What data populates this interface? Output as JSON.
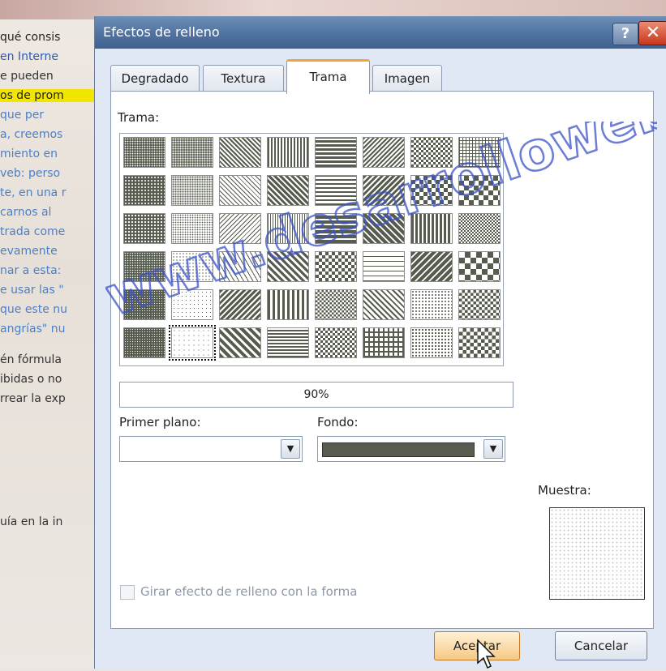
{
  "background_document": {
    "lines": [
      "qué consis",
      "en Interne",
      "e pueden",
      "os de prom",
      "que per",
      "a, creemos",
      "miento en",
      "veb: perso",
      "te, en una r",
      "carnos al",
      "trada come",
      "evamente",
      "nar a esta:",
      "e usar las \"",
      "que este nu",
      "angrías\" nu",
      "én fórmula",
      "ibidas o no",
      "rrear la exp",
      "uía en la in"
    ]
  },
  "dialog": {
    "title": "Efectos de relleno",
    "help_label": "?",
    "close_label": "✕",
    "tabs": [
      {
        "label": "Degradado",
        "active": false
      },
      {
        "label": "Textura",
        "active": false
      },
      {
        "label": "Trama",
        "active": true
      },
      {
        "label": "Imagen",
        "active": false
      }
    ],
    "pattern_label": "Trama:",
    "selected_pattern_name": "90%",
    "foreground_label": "Primer plano:",
    "foreground_value": "",
    "background_label": "Fondo:",
    "background_color": "#565c4e",
    "preview_label": "Muestra:",
    "rotate_checkbox_label": "Girar efecto de relleno con la forma",
    "rotate_checked": false,
    "ok_label": "Aceptar",
    "cancel_label": "Cancelar"
  },
  "watermark": "www.desarrolloweb.com"
}
